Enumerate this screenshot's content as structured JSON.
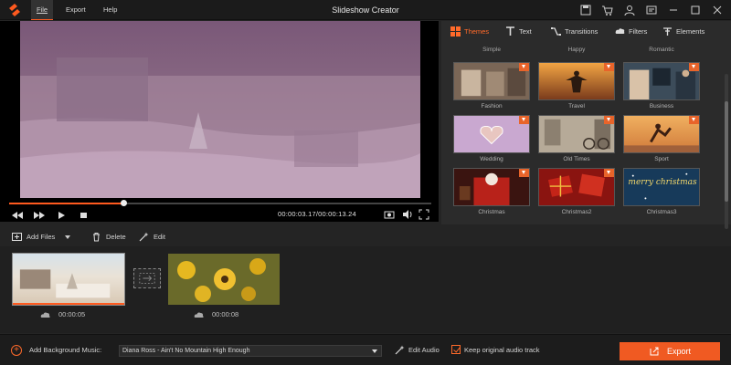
{
  "app": {
    "title": "Slideshow Creator"
  },
  "menu": {
    "file": "File",
    "export": "Export",
    "help": "Help"
  },
  "titlebar_icons": [
    "save-icon",
    "cart-icon",
    "profile-icon",
    "feedback-icon",
    "minimize-icon",
    "maximize-icon",
    "close-icon"
  ],
  "player": {
    "timecode": "00:00:03.17/00:00:13.24",
    "progress_fraction": 0.27
  },
  "tabs": [
    {
      "label": "Themes",
      "icon": "themes-icon",
      "active": true
    },
    {
      "label": "Text",
      "icon": "text-icon",
      "active": false
    },
    {
      "label": "Transitions",
      "icon": "transitions-icon",
      "active": false
    },
    {
      "label": "Filters",
      "icon": "filters-icon",
      "active": false
    },
    {
      "label": "Elements",
      "icon": "elements-icon",
      "active": false
    }
  ],
  "themes_top_row": [
    "Simple",
    "Happy",
    "Romantic"
  ],
  "themes": [
    {
      "label": "Fashion"
    },
    {
      "label": "Travel"
    },
    {
      "label": "Business"
    },
    {
      "label": "Wedding"
    },
    {
      "label": "Old Times"
    },
    {
      "label": "Sport"
    },
    {
      "label": "Christmas"
    },
    {
      "label": "Christmas2"
    },
    {
      "label": "Christmas3"
    }
  ],
  "christmas3_text": "merry christmas",
  "toolbar": {
    "add_files": "Add Files",
    "delete": "Delete",
    "edit": "Edit"
  },
  "clips": [
    {
      "duration": "00:00:05"
    },
    {
      "duration": "00:00:08"
    }
  ],
  "bottom": {
    "add_music_label": "Add Background Music:",
    "music_value": "Diana Ross - Ain't No Mountain High Enough",
    "edit_audio": "Edit Audio",
    "keep_audio": "Keep original audio track",
    "keep_audio_checked": true,
    "export": "Export"
  },
  "colors": {
    "accent": "#f05a22",
    "background": "#242424",
    "panel": "#2b2b2b"
  }
}
